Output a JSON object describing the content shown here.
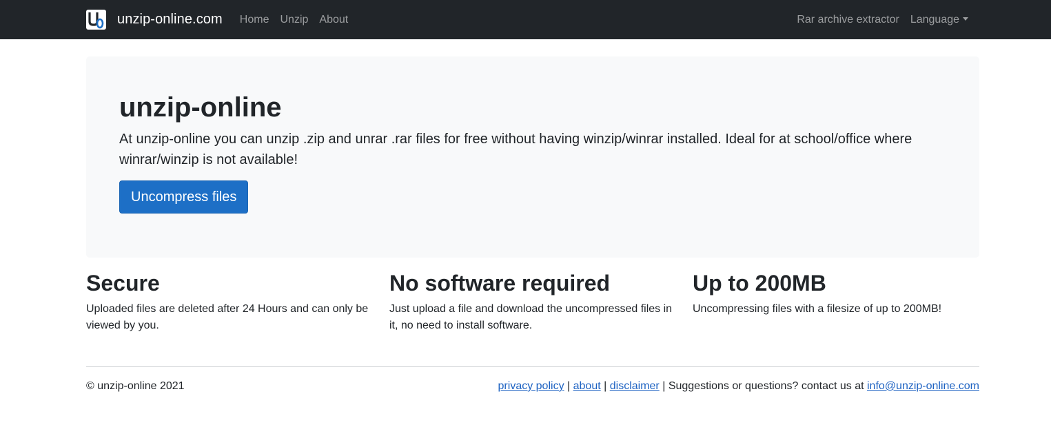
{
  "navbar": {
    "brand": "unzip-online.com",
    "logo_letters": "U0",
    "links": [
      "Home",
      "Unzip",
      "About"
    ],
    "right_links": {
      "rar": "Rar archive extractor",
      "language": "Language"
    },
    "bg_color": "#212529"
  },
  "hero": {
    "title": "unzip-online",
    "text": "At unzip-online you can unzip .zip and unrar .rar files for free without having winzip/winrar installed. Ideal for at school/office where winrar/winzip is not available!",
    "button_label": "Uncompress files",
    "button_color": "#1d6fc6"
  },
  "features": [
    {
      "title": "Secure",
      "text": "Uploaded files are deleted after 24 Hours and can only be viewed by you."
    },
    {
      "title": "No software required",
      "text": "Just upload a file and download the uncompressed files in it, no need to install software."
    },
    {
      "title": "Up to 200MB",
      "text": "Uncompressing files with a filesize of up to 200MB!"
    }
  ],
  "footer": {
    "copyright": "© unzip-online 2021",
    "links": {
      "privacy": "privacy policy",
      "about": "about",
      "disclaimer": "disclaimer"
    },
    "separator": "|",
    "contact_text": "Suggestions or questions? contact us at",
    "email": "info@unzip-online.com"
  }
}
